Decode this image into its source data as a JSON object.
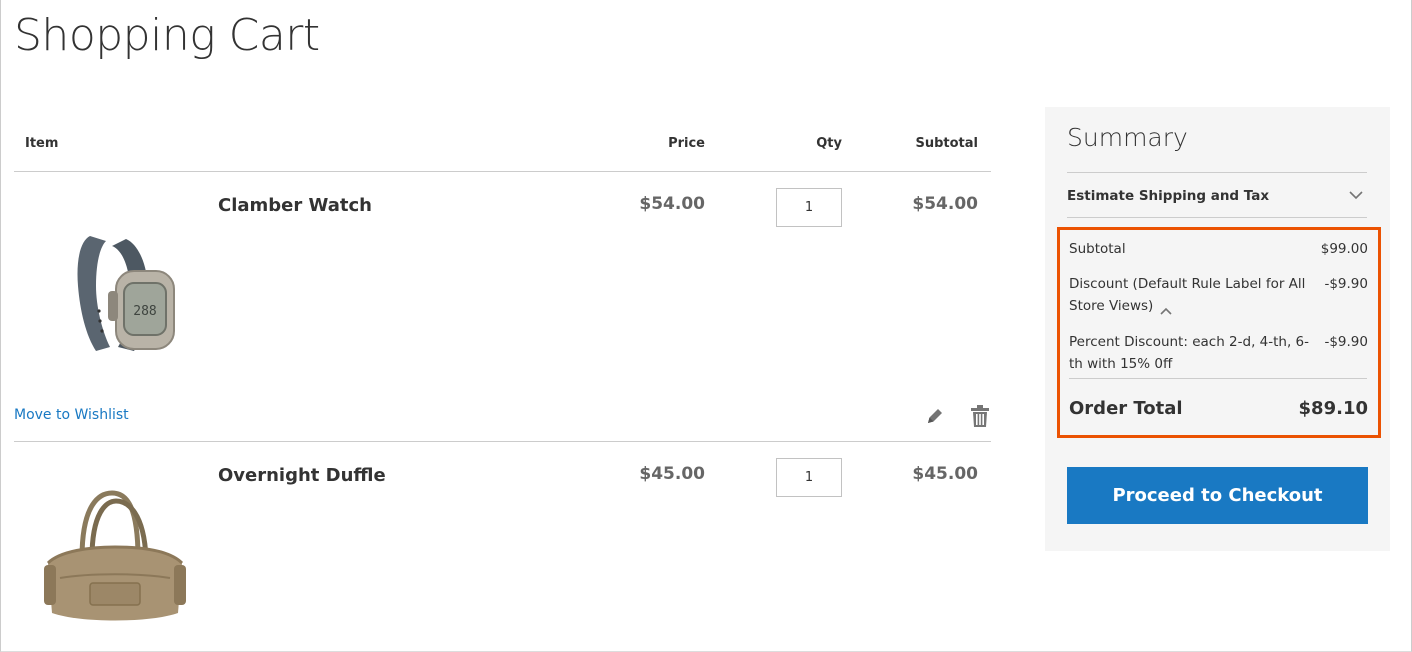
{
  "page": {
    "title": "Shopping Cart"
  },
  "cart": {
    "headers": {
      "item": "Item",
      "price": "Price",
      "qty": "Qty",
      "subtotal": "Subtotal"
    },
    "items": [
      {
        "name": "Clamber Watch",
        "price": "$54.00",
        "qty": "1",
        "subtotal": "$54.00",
        "image": "watch-image",
        "wishlist_label": "Move to Wishlist",
        "actions": [
          "edit-icon",
          "trash-icon"
        ]
      },
      {
        "name": "Overnight Duffle",
        "price": "$45.00",
        "qty": "1",
        "subtotal": "$45.00",
        "image": "duffle-bag-image"
      }
    ]
  },
  "summary": {
    "title": "Summary",
    "estimate_label": "Estimate Shipping and Tax",
    "estimate_icon": "chevron-down-icon",
    "totals": {
      "subtotal_label": "Subtotal",
      "subtotal_value": "$99.00",
      "discount_label": "Discount (Default Rule Label for All Store Views)",
      "discount_value": "-$9.90",
      "discount_icon": "chevron-up-icon",
      "percent_discount_label": "Percent Discount: each 2-d, 4-th, 6-th with 15% 0ff",
      "percent_discount_value": "-$9.90",
      "order_total_label": "Order Total",
      "order_total_value": "$89.10"
    },
    "checkout_label": "Proceed to Checkout"
  },
  "colors": {
    "accent": "#1979c3",
    "highlight_border": "#eb5202",
    "summary_bg": "#f5f5f5",
    "price_text": "#666666"
  }
}
